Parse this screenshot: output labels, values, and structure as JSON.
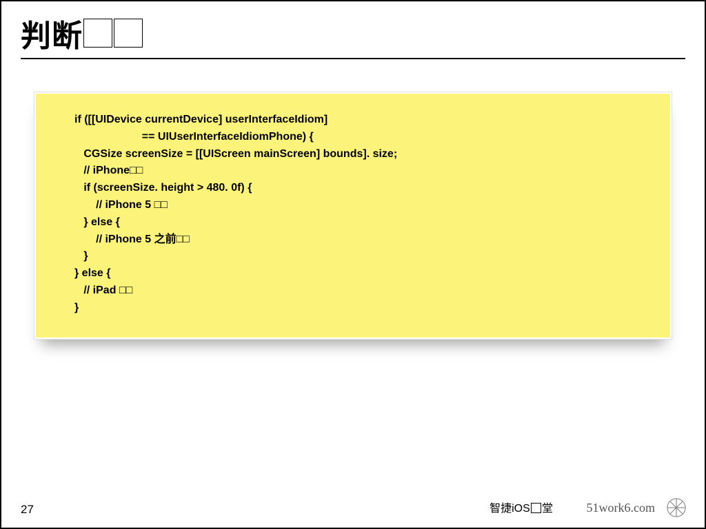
{
  "title_prefix": "判断",
  "code_lines": [
    "if ([[UIDevice currentDevice] userInterfaceIdiom]",
    "                      == UIUserInterfaceIdiomPhone) {",
    "   CGSize screenSize = [[UIScreen mainScreen] bounds]. size;",
    "   // iPhone□□",
    "   if (screenSize. height > 480. 0f) {",
    "       // iPhone 5 □□",
    "   } else {",
    "       // iPhone 5 之前□□",
    "   }",
    "} else {",
    "   // iPad □□",
    "}"
  ],
  "page_number": "27",
  "brand_cn_prefix": "智捷iOS",
  "brand_cn_suffix": "堂",
  "brand_en": "51work6.com"
}
